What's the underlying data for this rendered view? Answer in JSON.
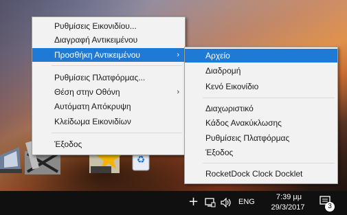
{
  "main_menu": {
    "items": [
      {
        "label": "Ρυθμίσεις Εικονιδίου...",
        "has_submenu": false
      },
      {
        "label": "Διαγραφή Αντικειμένου",
        "has_submenu": false
      },
      {
        "label": "Προσθήκη Αντικειμένου",
        "has_submenu": true,
        "highlighted": true
      },
      {
        "label": "Ρυθμίσεις Πλατφόρμας...",
        "has_submenu": false
      },
      {
        "label": "Θέση στην Οθόνη",
        "has_submenu": true
      },
      {
        "label": "Αυτόματη Απόκρυψη",
        "has_submenu": false
      },
      {
        "label": "Κλείδωμα Εικονιδίων",
        "has_submenu": false
      },
      {
        "label": "Έξοδος",
        "has_submenu": false
      }
    ],
    "submenu_arrow": "›"
  },
  "submenu": {
    "items": [
      {
        "label": "Αρχείο",
        "highlighted": true
      },
      {
        "label": "Διαδρομή"
      },
      {
        "label": "Κενό Εικονίδιο"
      },
      {
        "label": "Διαχωριστικό"
      },
      {
        "label": "Κάδος Ανακύκλωσης"
      },
      {
        "label": "Ρυθμίσεις Πλατφόρμας"
      },
      {
        "label": "Έξοδος"
      },
      {
        "label": "RocketDock Clock Docklet"
      }
    ]
  },
  "dock": {
    "icons": [
      "ship-icon",
      "tools-icon",
      "star-folder-icon",
      "recycle-bin-icon"
    ]
  },
  "taskbar": {
    "tray_icons": [
      "plus-icon",
      "network-icon",
      "volume-icon"
    ],
    "language": "ENG",
    "time": "7:39 μμ",
    "date": "29/3/2017",
    "notification_count": "3"
  },
  "colors": {
    "highlight": "#1f7ad6",
    "menu_bg": "#f2f2f2",
    "taskbar_bg": "#101010"
  }
}
